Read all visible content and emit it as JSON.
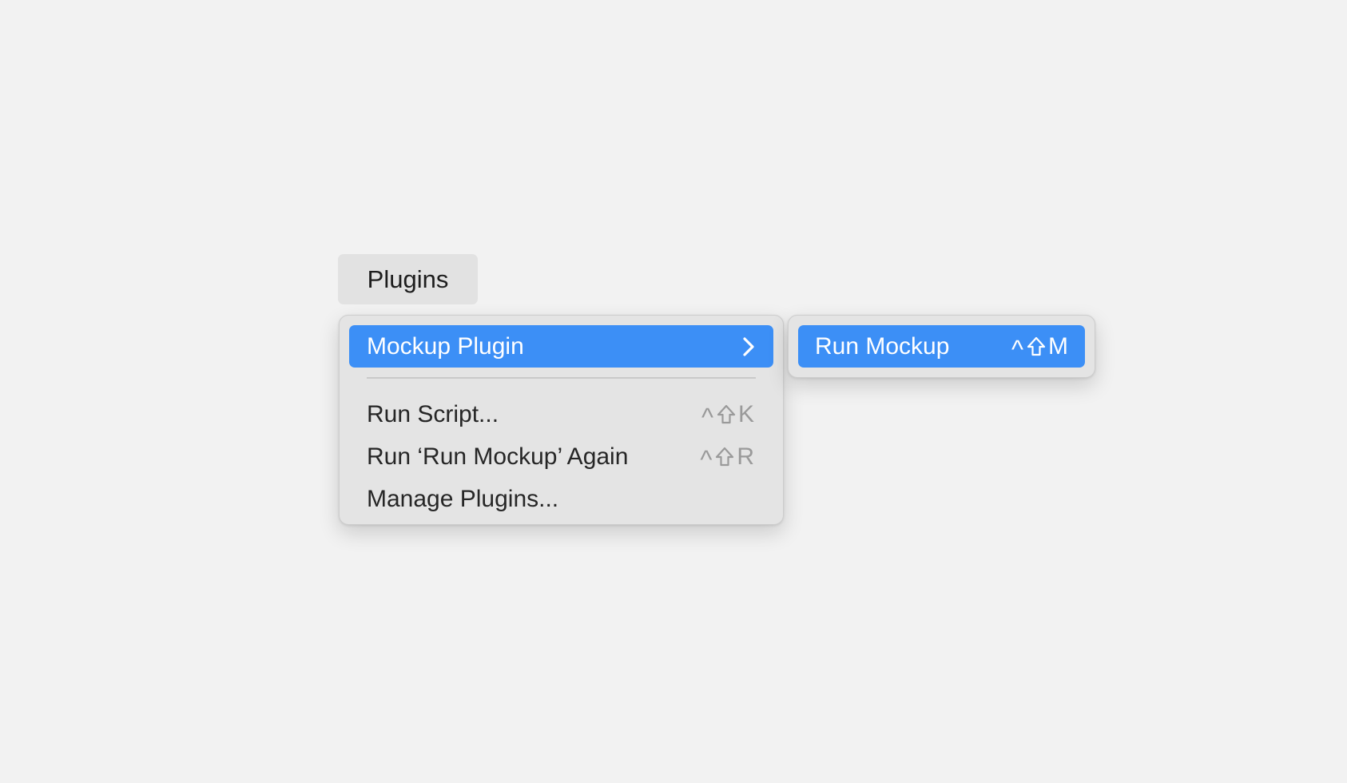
{
  "menubar": {
    "label": "Plugins"
  },
  "main_menu": {
    "highlighted_item": {
      "label": "Mockup Plugin",
      "icon": "chevron-right-icon"
    },
    "items": [
      {
        "label": "Run Script...",
        "shortcut": {
          "control": "^",
          "shift_icon": "shift-icon",
          "key": "K"
        }
      },
      {
        "label": "Run ‘Run Mockup’ Again",
        "shortcut": {
          "control": "^",
          "shift_icon": "shift-icon",
          "key": "R"
        }
      },
      {
        "label": "Manage Plugins..."
      }
    ]
  },
  "sub_menu": {
    "items": [
      {
        "label": "Run Mockup",
        "shortcut": {
          "control": "^",
          "shift_icon": "shift-icon",
          "key": "M"
        }
      }
    ]
  },
  "colors": {
    "background": "#f2f2f2",
    "menu_background": "#e4e4e4",
    "highlight": "#3c8ff6",
    "text": "#262626",
    "shortcut_text": "#9a9a9a"
  }
}
